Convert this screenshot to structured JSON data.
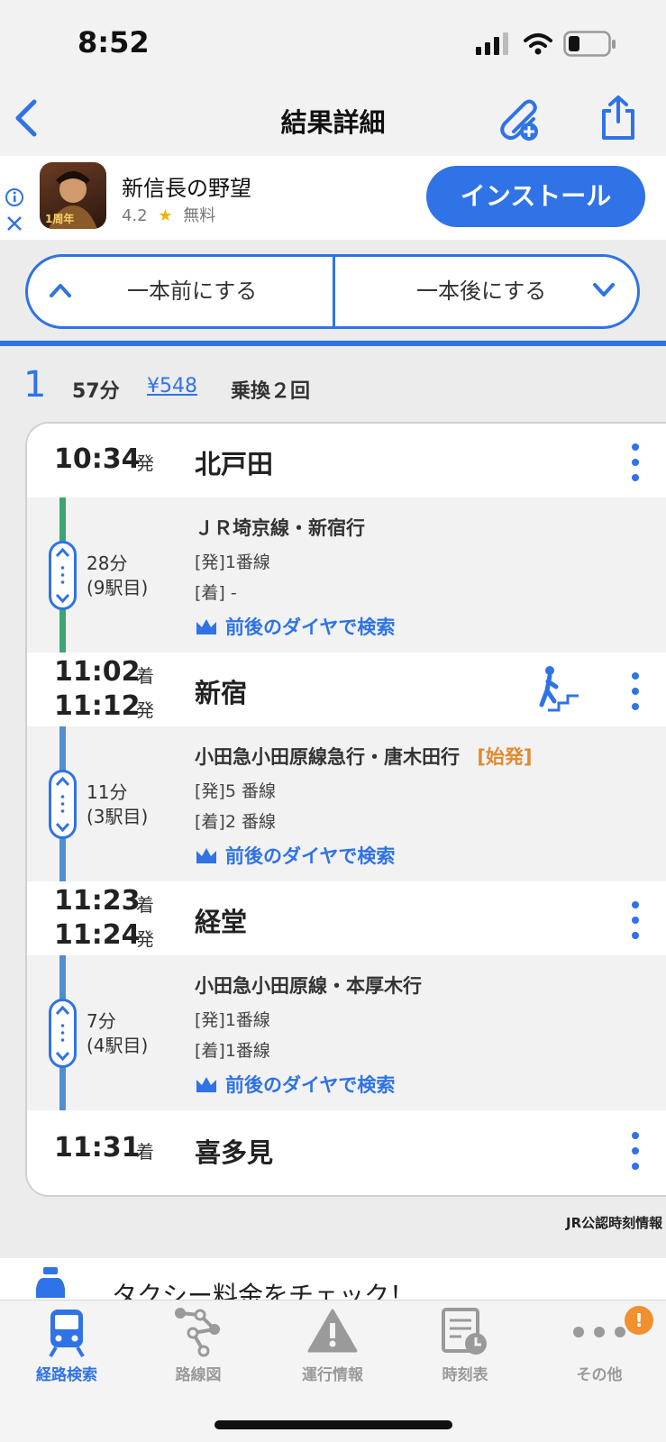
{
  "status_bar": {
    "time": "8:52"
  },
  "nav": {
    "title": "結果詳細"
  },
  "ad": {
    "name": "新信長の野望",
    "rating": "4.2",
    "price": "無料",
    "install_label": "インストール",
    "badge": "1周年"
  },
  "switch": {
    "prev_label": "一本前にする",
    "next_label": "一本後にする"
  },
  "summary": {
    "route_number": "1",
    "duration": "57分",
    "fare": "¥548",
    "transfers": "乗換２回"
  },
  "stations": [
    {
      "name": "北戸田",
      "times": [
        {
          "time": "10:34",
          "label": "発"
        }
      ],
      "transfer_icon": false
    },
    {
      "name": "新宿",
      "times": [
        {
          "time": "11:02",
          "label": "着"
        },
        {
          "time": "11:12",
          "label": "発"
        }
      ],
      "transfer_icon": true
    },
    {
      "name": "経堂",
      "times": [
        {
          "time": "11:23",
          "label": "着"
        },
        {
          "time": "11:24",
          "label": "発"
        }
      ],
      "transfer_icon": false
    },
    {
      "name": "喜多見",
      "times": [
        {
          "time": "11:31",
          "label": "着"
        }
      ],
      "transfer_icon": false
    }
  ],
  "segments": [
    {
      "line": "ＪＲ埼京線・新宿行",
      "tag": "",
      "minutes": "28分",
      "stops": "(9駅目)",
      "depart_platform": "[発]1番線",
      "arrive_platform": "[着] -",
      "search_label": "前後のダイヤで検索",
      "color": "#3aa672"
    },
    {
      "line": "小田急小田原線急行・唐木田行",
      "tag": "[始発]",
      "minutes": "11分",
      "stops": "(3駅目)",
      "depart_platform": "[発]5 番線",
      "arrive_platform": "[着]2 番線",
      "search_label": "前後のダイヤで検索",
      "color": "#4f8fd0"
    },
    {
      "line": "小田急小田原線・本厚木行",
      "tag": "",
      "minutes": "7分",
      "stops": "(4駅目)",
      "depart_platform": "[発]1番線",
      "arrive_platform": "[着]1番線",
      "search_label": "前後のダイヤで検索",
      "color": "#4f8fd0"
    }
  ],
  "footer_credit": "JR公認時刻情報",
  "taxi_banner": "タクシー料金をチェック！",
  "tabs": [
    {
      "label": "経路検索",
      "icon": "train-icon",
      "active": true
    },
    {
      "label": "路線図",
      "icon": "route-map-icon",
      "active": false
    },
    {
      "label": "運行情報",
      "icon": "warning-icon",
      "active": false
    },
    {
      "label": "時刻表",
      "icon": "timetable-icon",
      "active": false
    },
    {
      "label": "その他",
      "icon": "more-icon",
      "active": false,
      "badge": "!"
    }
  ],
  "colors": {
    "accent": "#2f73e6",
    "jr_saikyo": "#3aa672",
    "odakyu": "#4f8fd0",
    "badge": "#f0902e"
  }
}
